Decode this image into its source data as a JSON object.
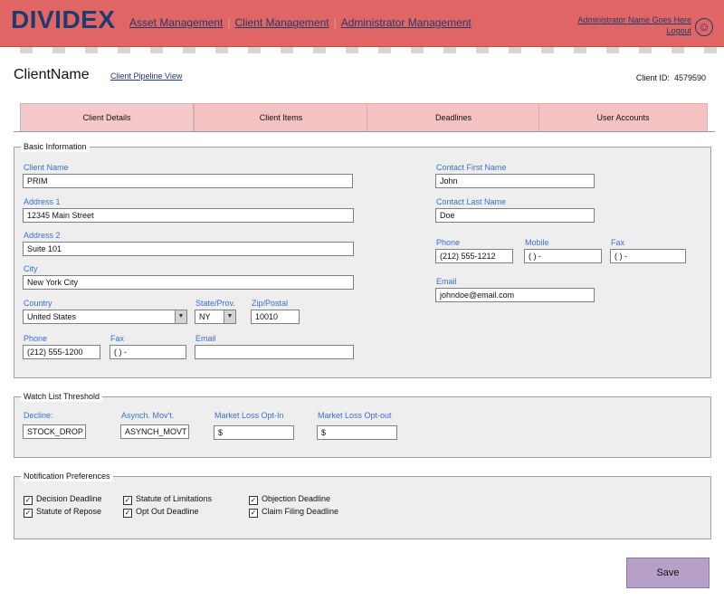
{
  "header": {
    "logo": "DIVIDEX",
    "nav": [
      "Asset Management",
      "Client Management",
      "Administrator Management"
    ],
    "admin_name": "Administrator Name Goes Here",
    "logout": "Logout",
    "smiley": "☺"
  },
  "client": {
    "name": "ClientName",
    "pipeline_link": "Client Pipeline View",
    "id_label": "Client ID:",
    "id_value": "4579590"
  },
  "tabs": [
    "Client Details",
    "Client Items",
    "Deadlines",
    "User Accounts"
  ],
  "basic": {
    "legend": "Basic Information",
    "client_name_label": "Client Name",
    "client_name": "PRIM",
    "address1_label": "Address 1",
    "address1": "12345 Main Street",
    "address2_label": "Address 2",
    "address2": "Suite 101",
    "city_label": "City",
    "city": "New York City",
    "country_label": "Country",
    "country": "United States",
    "state_label": "State/Prov.",
    "state": "NY",
    "zip_label": "Zip/Postal",
    "zip": "10010",
    "phone_label": "Phone",
    "phone": "(212) 555-1200",
    "fax_label": "Fax",
    "fax": "(    )      -",
    "email_label": "Email",
    "email": "",
    "contact_first_label": "Contact First Name",
    "contact_first": "John",
    "contact_last_label": "Contact Last Name",
    "contact_last": "Doe",
    "c_phone_label": "Phone",
    "c_phone": "(212) 555-1212",
    "c_mobile_label": "Mobile",
    "c_mobile": "(    )      -",
    "c_fax_label": "Fax",
    "c_fax": "(    )      -",
    "c_email_label": "Email",
    "c_email": "johndoe@email.com",
    "dropdown_arrow": "▼"
  },
  "watch": {
    "legend": "Watch List Threshold",
    "decline_label": "Decline:",
    "decline": "STOCK_DROP",
    "asynch_label": "Asynch. Mov't.",
    "asynch": "ASYNCH_MOVT",
    "optin_label": "Market Loss Opt-In",
    "optin": "$",
    "optout_label": "Market Loss Opt-out",
    "optout": "$"
  },
  "notif": {
    "legend": "Notification Preferences",
    "check_glyph": "✓",
    "items": [
      "Decision Deadline",
      "Statute of Limitations",
      "Objection Deadline",
      "Statute of Repose",
      "Opt Out Deadline",
      "Claim Filing Deadline"
    ]
  },
  "save_label": "Save"
}
